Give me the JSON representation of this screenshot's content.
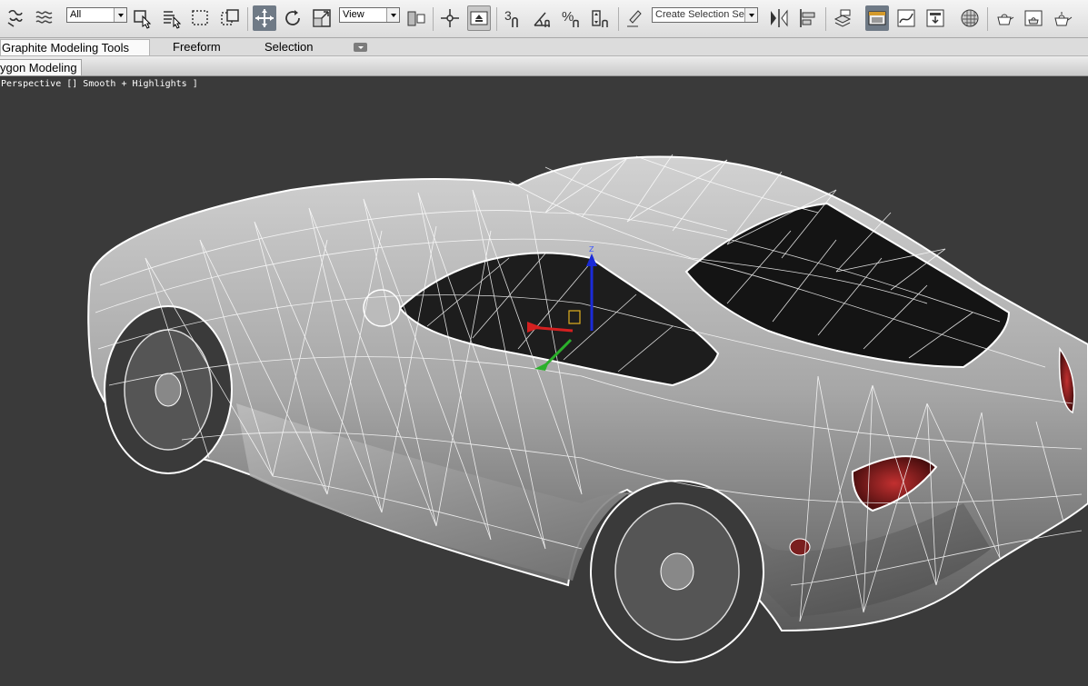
{
  "toolbar": {
    "selection_filter": "All",
    "coord_system": "View",
    "named_selection_placeholder": "Create Selection Se",
    "icons": [
      "link-icon",
      "unlink-icon",
      "select-object-icon",
      "select-by-name-icon",
      "rect-selection-region-icon",
      "window-crossing-icon",
      "select-and-move-icon",
      "select-and-rotate-icon",
      "select-and-scale-icon",
      "pivot-center-icon",
      "select-and-manipulate-icon",
      "keyboard-shortcut-override-icon",
      "snaps-toggle-icon",
      "angle-snap-icon",
      "percent-snap-icon",
      "spinner-snap-icon",
      "edit-named-selection-icon",
      "mirror-icon",
      "align-icon",
      "layer-manager-icon",
      "graphite-tools-icon",
      "curve-editor-icon",
      "schematic-view-icon",
      "material-editor-icon",
      "render-setup-icon",
      "rendered-frame-icon",
      "render-production-icon"
    ],
    "snap_number": "3",
    "percent_label": "%"
  },
  "ribbon": {
    "tabs": [
      {
        "label": "Graphite Modeling Tools",
        "active": true
      },
      {
        "label": "Freeform",
        "active": false
      },
      {
        "label": "Selection",
        "active": false
      }
    ]
  },
  "panel": {
    "tab_label": "ygon Modeling"
  },
  "viewport": {
    "label": "Perspective [] Smooth + Highlights ]",
    "background": "#3a3a3a",
    "gizmo_axis_label": "Z"
  }
}
